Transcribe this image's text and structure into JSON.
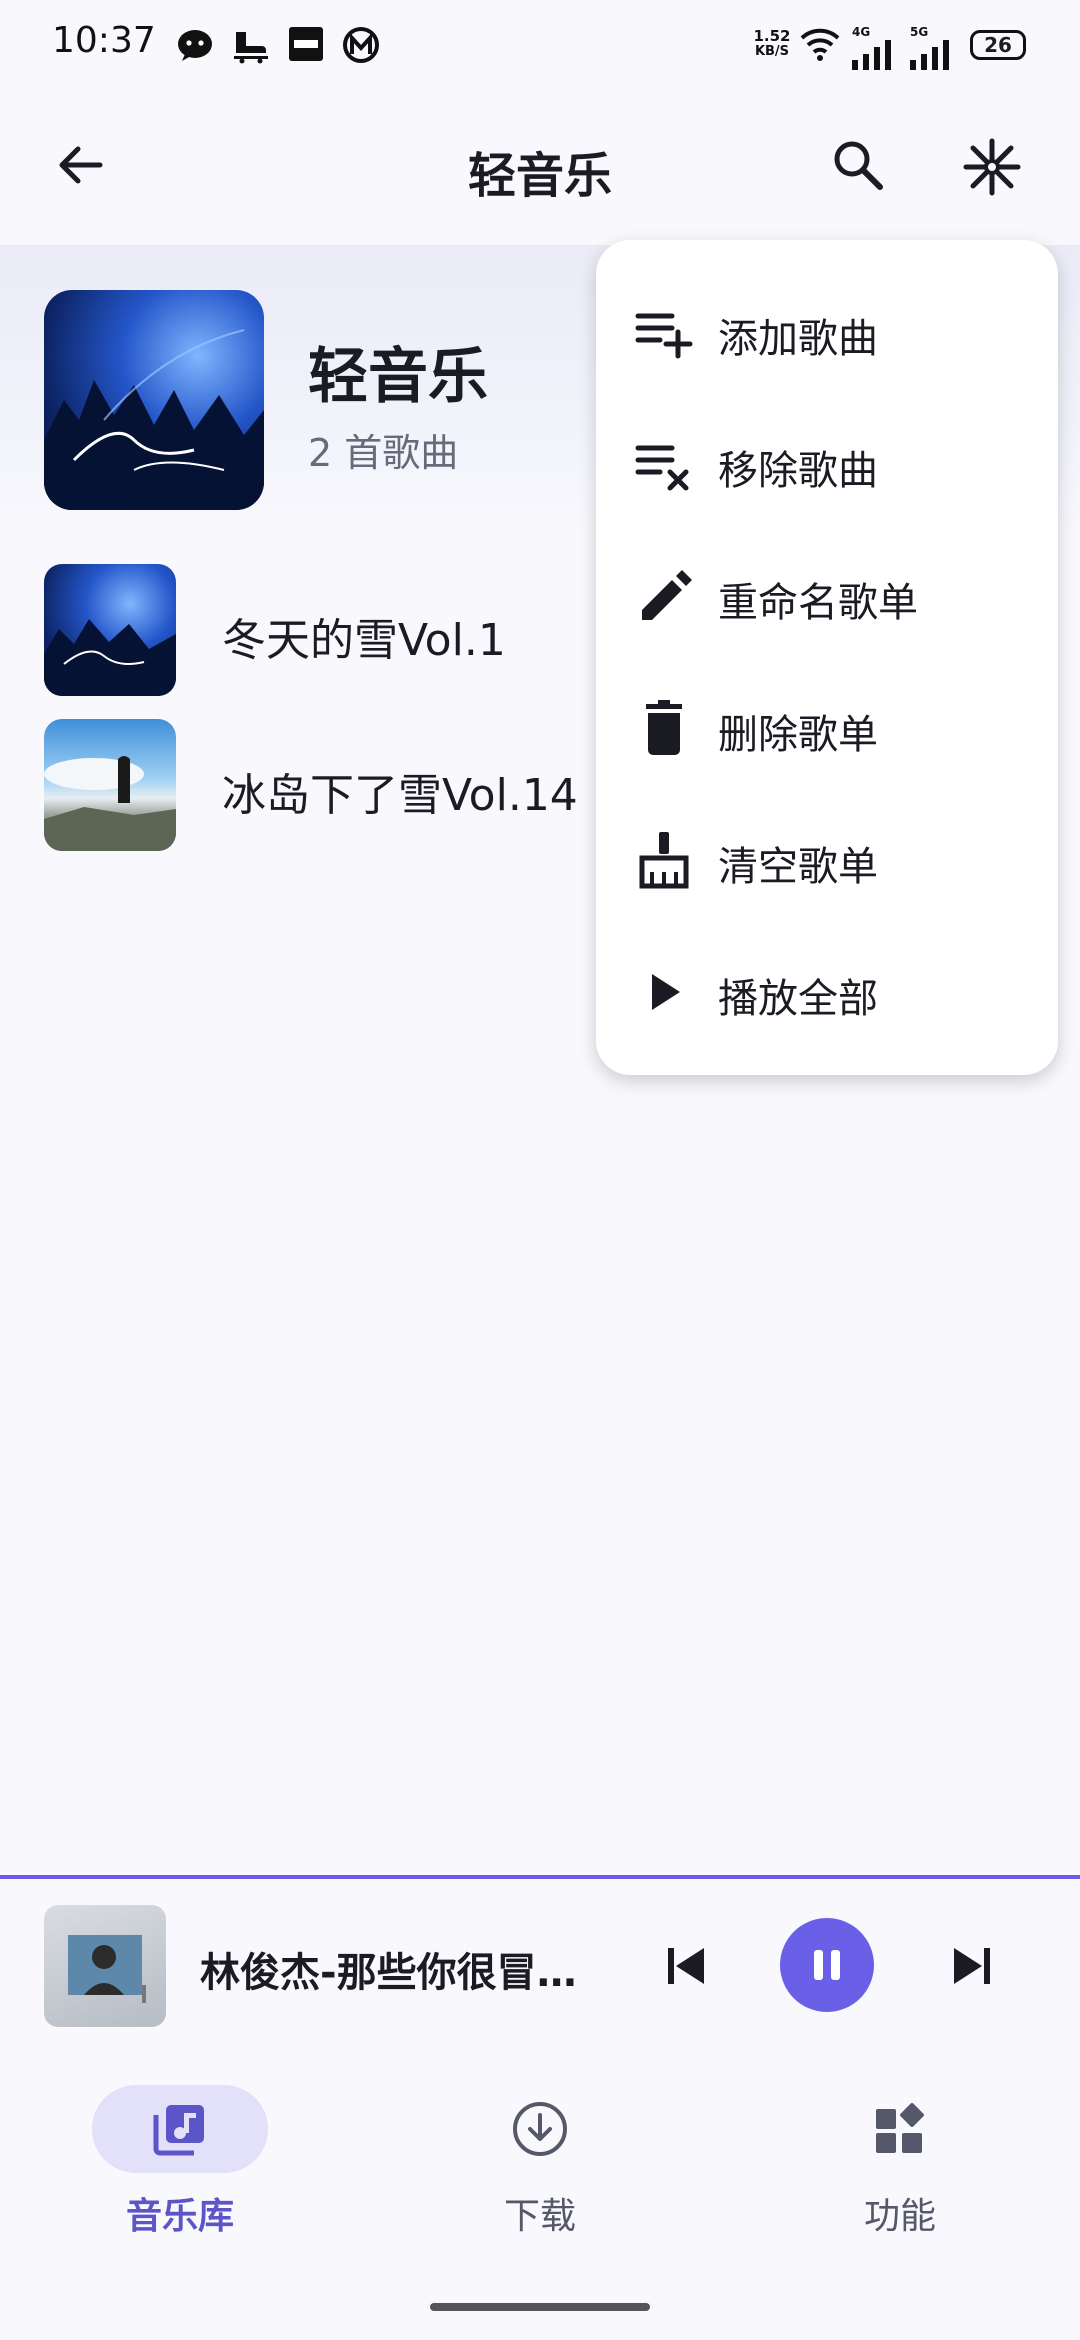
{
  "status_bar": {
    "time": "10:37",
    "net_speed": "1.52",
    "net_unit": "KB/S",
    "net_4g": "4G",
    "net_5g": "5G",
    "battery": "26",
    "icons": [
      "wechat-icon",
      "skate-icon",
      "mi-app-icon",
      "metro-icon",
      "wifi-icon",
      "signal-4g-icon",
      "signal-5g-icon",
      "battery-icon"
    ]
  },
  "app_bar": {
    "title": "轻音乐",
    "icons": [
      "back-arrow-icon",
      "search-icon",
      "snowflake-icon"
    ]
  },
  "playlist": {
    "name": "轻音乐",
    "count": "2 首歌曲"
  },
  "songs": [
    {
      "title": "冬天的雪Vol.1"
    },
    {
      "title": "冰岛下了雪Vol.14"
    }
  ],
  "menu": {
    "items": [
      {
        "label": "添加歌曲",
        "icon": "playlist-add-icon"
      },
      {
        "label": "移除歌曲",
        "icon": "playlist-remove-icon"
      },
      {
        "label": "重命名歌单",
        "icon": "pencil-icon"
      },
      {
        "label": "删除歌单",
        "icon": "trash-icon"
      },
      {
        "label": "清空歌单",
        "icon": "broom-icon"
      },
      {
        "label": "播放全部",
        "icon": "play-icon"
      }
    ]
  },
  "mini_player": {
    "title": "林俊杰-那些你很冒险的梦",
    "icons": [
      "skip-previous-icon",
      "pause-icon",
      "skip-next-icon"
    ]
  },
  "bottom_nav": {
    "items": [
      {
        "label": "音乐库",
        "icon": "music-library-icon",
        "active": true
      },
      {
        "label": "下载",
        "icon": "download-icon",
        "active": false
      },
      {
        "label": "功能",
        "icon": "widgets-icon",
        "active": false
      }
    ]
  },
  "colors": {
    "accent": "#6a60e8",
    "nav_active_text": "#5b55c8",
    "nav_pill": "#e3e0f9",
    "background": "#f8f8fd",
    "text_primary": "#1b1b23",
    "text_secondary": "#666a7a"
  }
}
